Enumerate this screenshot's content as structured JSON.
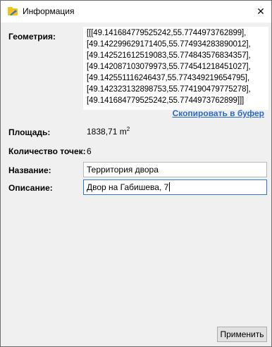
{
  "window": {
    "title": "Информация",
    "close_glyph": "✕"
  },
  "geometry": {
    "label": "Геометрия:",
    "lines": [
      "[[[49.141684779525242,55.7744973762899],",
      "[49.142299629171405,55.774934283890012],",
      "[49.142521612519083,55.774843576834357],",
      "[49.142087103079973,55.774541218451027],",
      "[49.142551116246437,55.774349219654795],",
      "[49.142323132898753,55.774190479775278],",
      "[49.141684779525242,55.7744973762899]]]"
    ],
    "copy_link": "Скопировать в буфер"
  },
  "area": {
    "label": "Площадь:",
    "value": "1838,71 m",
    "unit_sup": "2"
  },
  "point_count": {
    "label": "Количество точек:",
    "value": "6"
  },
  "name": {
    "label": "Название:",
    "value": "Территория двора"
  },
  "description": {
    "label": "Описание:",
    "value": "Двор на Габишева, 7"
  },
  "apply_button": "Применить",
  "colors": {
    "link": "#2a6ac9",
    "focus_border": "#2f7bd0",
    "icon_yellow": "#f2c318",
    "icon_blue": "#2f7bd0"
  }
}
